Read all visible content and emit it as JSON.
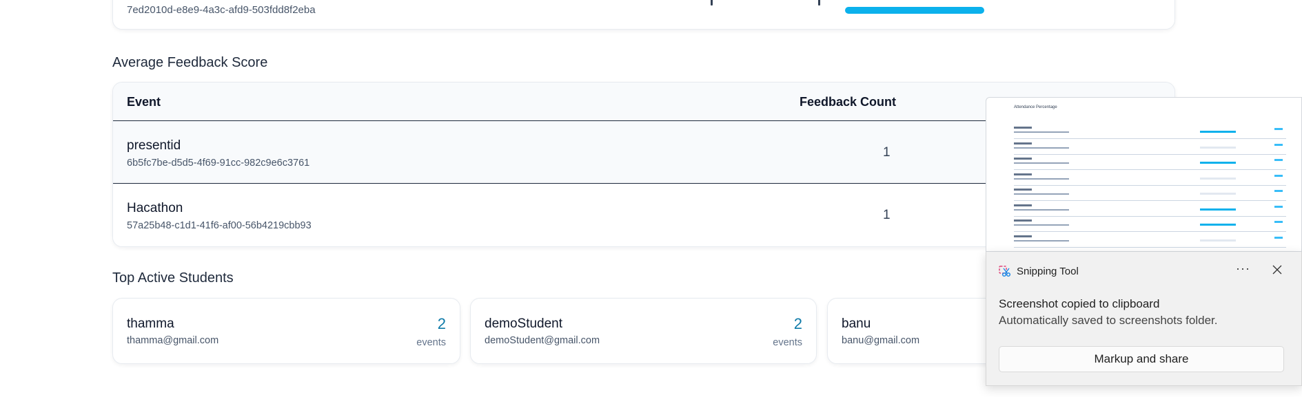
{
  "top_card": {
    "event_id": "7ed2010d-e8e9-4a3c-afd9-503fdd8f2eba",
    "progress_fraction": 1.0,
    "progress_color": "#0bb1ec"
  },
  "feedback": {
    "title": "Average Feedback Score",
    "columns": {
      "event": "Event",
      "count": "Feedback Count"
    },
    "rows": [
      {
        "name": "presentid",
        "id": "6b5fc7be-d5d5-4f69-91cc-982c9e6c3761",
        "count": "1"
      },
      {
        "name": "Hacathon",
        "id": "57a25b48-c1d1-41f6-af00-56b4219cbb93",
        "count": "1"
      }
    ]
  },
  "students": {
    "title": "Top Active Students",
    "items": [
      {
        "name": "thamma",
        "email": "thamma@gmail.com",
        "count": "2",
        "unit": "events"
      },
      {
        "name": "demoStudent",
        "email": "demoStudent@gmail.com",
        "count": "2",
        "unit": "events"
      },
      {
        "name": "banu",
        "email": "banu@gmail.com"
      }
    ]
  },
  "snipping_tool": {
    "app_name": "Snipping Tool",
    "message_title": "Screenshot copied to clipboard",
    "message_body": "Automatically saved to screenshots folder.",
    "action_label": "Markup and share",
    "more_label": "···",
    "icons": {
      "app": "snipping-tool-icon",
      "close": "close-icon"
    },
    "thumbnail": {
      "title": "Attendance Percentage",
      "rows": [
        {
          "full": true
        },
        {
          "full": false
        },
        {
          "full": true
        },
        {
          "full": false
        },
        {
          "full": false
        },
        {
          "full": true
        },
        {
          "full": true
        },
        {
          "full": false
        }
      ]
    }
  },
  "colors": {
    "accent": "#0e7aa8",
    "progress": "#0bb1ec"
  }
}
